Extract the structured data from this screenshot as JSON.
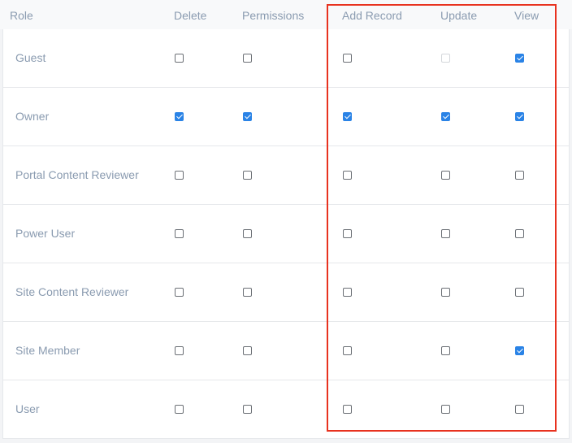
{
  "table": {
    "headers": {
      "role": "Role",
      "delete": "Delete",
      "permissions": "Permissions",
      "add_record": "Add Record",
      "update": "Update",
      "view": "View"
    },
    "rows": [
      {
        "role": "Guest",
        "delete": false,
        "permissions": false,
        "add_record": false,
        "update": "disabled",
        "view": true
      },
      {
        "role": "Owner",
        "delete": true,
        "permissions": true,
        "add_record": true,
        "update": true,
        "view": true
      },
      {
        "role": "Portal Content Reviewer",
        "delete": false,
        "permissions": false,
        "add_record": false,
        "update": false,
        "view": false
      },
      {
        "role": "Power User",
        "delete": false,
        "permissions": false,
        "add_record": false,
        "update": false,
        "view": false
      },
      {
        "role": "Site Content Reviewer",
        "delete": false,
        "permissions": false,
        "add_record": false,
        "update": false,
        "view": false
      },
      {
        "role": "Site Member",
        "delete": false,
        "permissions": false,
        "add_record": false,
        "update": false,
        "view": true
      },
      {
        "role": "User",
        "delete": false,
        "permissions": false,
        "add_record": false,
        "update": false,
        "view": false
      }
    ]
  },
  "colors": {
    "accent": "#2a83e6",
    "highlight_border": "#e8321f",
    "text_muted": "#8a9bb0"
  }
}
